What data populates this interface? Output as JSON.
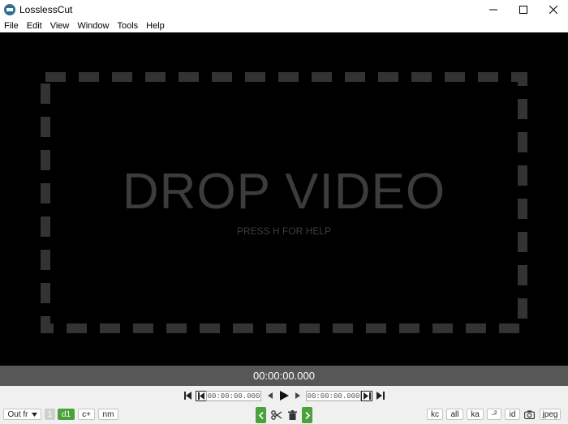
{
  "window": {
    "title": "LosslessCut"
  },
  "menu": [
    "File",
    "Edit",
    "View",
    "Window",
    "Tools",
    "Help"
  ],
  "dropzone": {
    "title": "DROP VIDEO",
    "hint": "PRESS H FOR HELP"
  },
  "timeline": {
    "current_time": "00:00:00.000"
  },
  "controls": {
    "cut_start_time": "00:00:00.000",
    "cut_end_time": "00:00:00.000",
    "output_format_label": "Out fr",
    "segment_count": "1",
    "left_buttons": [
      "d1",
      "c+",
      "nm"
    ],
    "right_buttons": [
      "kc",
      "all",
      "ka",
      "-²",
      "id",
      "jpeg"
    ]
  },
  "colors": {
    "accent_green": "#4aa23a",
    "timebar": "#575757",
    "dropzone_dash": "#333333"
  }
}
